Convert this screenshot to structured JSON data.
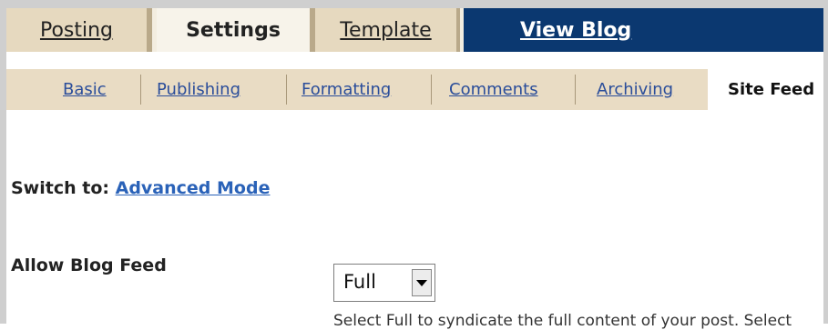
{
  "tabs": {
    "posting": "Posting",
    "settings": "Settings",
    "template": "Template",
    "view_blog": "View Blog"
  },
  "subtabs": [
    "Basic",
    "Publishing",
    "Formatting",
    "Comments",
    "Archiving",
    "Site Feed"
  ],
  "active_subtab": "Site Feed",
  "switch": {
    "label": "Switch to:",
    "link": "Advanced Mode"
  },
  "allow_feed": {
    "label": "Allow Blog Feed",
    "selected": "Full",
    "help": "Select Full to syndicate the full content of your post. Select"
  },
  "colors": {
    "active_tab": "#f7f3ea",
    "tab_bar": "#f3ede0",
    "view_blog": "#0b3870",
    "link": "#2a62b8"
  }
}
